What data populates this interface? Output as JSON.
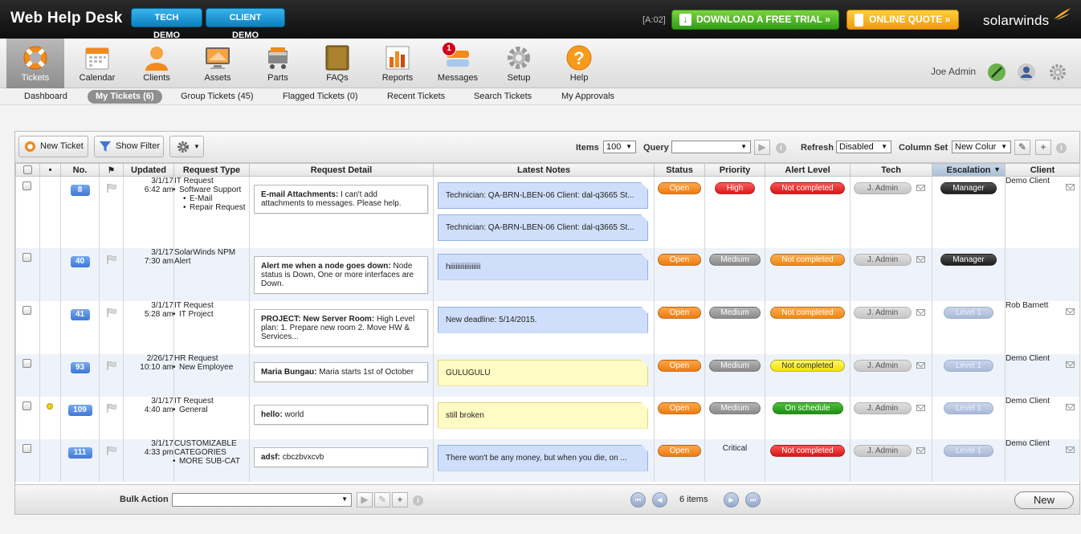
{
  "header": {
    "title": "Web Help Desk",
    "tech_demo": "TECH DEMO",
    "client_demo": "CLIENT DEMO",
    "version": "[A:02]",
    "download_trial": "DOWNLOAD A FREE TRIAL »",
    "online_quote": "ONLINE QUOTE »",
    "brand": "solarwinds",
    "colors": {
      "accent": "#0b80c0",
      "trial": "#2f9e16",
      "quote": "#f19a0e",
      "brand_flame": "#f5a623"
    }
  },
  "nav": {
    "items": [
      {
        "label": "Tickets",
        "icon": "lifebuoy-icon",
        "active": true
      },
      {
        "label": "Calendar",
        "icon": "calendar-icon"
      },
      {
        "label": "Clients",
        "icon": "person-icon"
      },
      {
        "label": "Assets",
        "icon": "monitor-icon"
      },
      {
        "label": "Parts",
        "icon": "cart-icon"
      },
      {
        "label": "FAQs",
        "icon": "book-icon"
      },
      {
        "label": "Reports",
        "icon": "report-icon"
      },
      {
        "label": "Messages",
        "icon": "message-icon",
        "badge": "1"
      },
      {
        "label": "Setup",
        "icon": "gear-icon"
      },
      {
        "label": "Help",
        "icon": "help-icon"
      }
    ],
    "user": "Joe Admin"
  },
  "subnav": {
    "items": [
      "Dashboard",
      "My Tickets (6)",
      "Group Tickets (45)",
      "Flagged Tickets (0)",
      "Recent Tickets",
      "Search Tickets",
      "My Approvals"
    ],
    "active": "My Tickets (6)"
  },
  "toolbar": {
    "new_ticket": "New Ticket",
    "show_filter": "Show Filter",
    "items_label": "Items",
    "items_value": "100",
    "query_label": "Query",
    "query_value": "",
    "refresh_label": "Refresh",
    "refresh_value": "Disabled",
    "column_set_label": "Column Set",
    "column_set_value": "New Colur"
  },
  "columns": [
    "",
    "•",
    "No.",
    "",
    "Updated",
    "Request Type",
    "Request Detail",
    "Latest Notes",
    "Status",
    "Priority",
    "Alert Level",
    "Tech",
    "Escalation",
    "Client"
  ],
  "rows": [
    {
      "no": "8",
      "date": "3/1/17",
      "time": "6:42 am",
      "rtype": "IT Request",
      "rsub": [
        {
          "t": "Software Support",
          "lvl": 1
        },
        {
          "t": "E-Mail",
          "lvl": 2
        },
        {
          "t": "Repair Request",
          "lvl": 2
        }
      ],
      "detail_title": "E-mail Attachments:",
      "detail_body": "I can't add attachments to messages. Please help.",
      "notes": [
        "Technician: QA-BRN-LBEN-06 Client: dal-q3665 St...",
        "Technician: QA-BRN-LBEN-06 Client: dal-q3665 St..."
      ],
      "note_color": "blue",
      "status": "Open",
      "priority": "High",
      "priority_style": "high",
      "alert": "Not completed",
      "alert_style": "red",
      "tech": "J. Admin",
      "escalation": "Manager",
      "esc_style": "mgr",
      "client": "Demo Client",
      "dot": false
    },
    {
      "no": "40",
      "date": "3/1/17",
      "time": "7:30 am",
      "rtype": "SolarWinds NPM Alert",
      "rsub": [],
      "detail_title": "Alert me when a node goes down:",
      "detail_body": "Node status is Down, One or more interfaces are Down.",
      "notes": [
        "hiiiiiiiiiiiiiiiii"
      ],
      "note_color": "blue",
      "status": "Open",
      "priority": "Medium",
      "priority_style": "med",
      "alert": "Not completed",
      "alert_style": "orange",
      "tech": "J. Admin",
      "escalation": "Manager",
      "esc_style": "mgr",
      "client": "",
      "dot": false
    },
    {
      "no": "41",
      "date": "3/1/17",
      "time": "5:28 am",
      "rtype": "IT Request",
      "rsub": [
        {
          "t": "IT Project",
          "lvl": 1
        }
      ],
      "detail_title": "PROJECT: New Server Room:",
      "detail_body": "High Level plan: 1. Prepare new room 2. Move HW & Services...",
      "notes": [
        "New deadline: 5/14/2015."
      ],
      "note_color": "blue",
      "status": "Open",
      "priority": "Medium",
      "priority_style": "med",
      "alert": "Not completed",
      "alert_style": "orange",
      "tech": "J. Admin",
      "escalation": "Level 1",
      "esc_style": "lvl",
      "client": "Rob Barnett",
      "dot": false
    },
    {
      "no": "93",
      "date": "2/26/17",
      "time": "10:10 am",
      "rtype": "HR Request",
      "rsub": [
        {
          "t": "New Employee",
          "lvl": 1
        }
      ],
      "detail_title": "Maria Bungau:",
      "detail_body": "Maria starts 1st of October",
      "notes": [
        "GULUGULU"
      ],
      "note_color": "yellow",
      "status": "Open",
      "priority": "Medium",
      "priority_style": "med",
      "alert": "Not completed",
      "alert_style": "yellow",
      "tech": "J. Admin",
      "escalation": "Level 1",
      "esc_style": "lvl",
      "client": "Demo Client",
      "dot": false
    },
    {
      "no": "109",
      "date": "3/1/17",
      "time": "4:40 am",
      "rtype": "IT Request",
      "rsub": [
        {
          "t": "General",
          "lvl": 1
        }
      ],
      "detail_title": "hello:",
      "detail_body": "world",
      "notes": [
        "still broken"
      ],
      "note_color": "yellow",
      "status": "Open",
      "priority": "Medium",
      "priority_style": "med",
      "alert": "On schedule",
      "alert_style": "green",
      "tech": "J. Admin",
      "escalation": "Level 1",
      "esc_style": "lvl",
      "client": "Demo Client",
      "dot": true
    },
    {
      "no": "111",
      "date": "3/1/17",
      "time": "4:33 pm",
      "rtype": "CUSTOMIZABLE CATEGORIES",
      "rsub": [
        {
          "t": "MORE SUB-CAT",
          "lvl": 1
        }
      ],
      "detail_title": "adsf:",
      "detail_body": "cbczbvxcvb",
      "notes": [
        "There won't be any money, but when you die, on ..."
      ],
      "note_color": "blue",
      "status": "Open",
      "priority": "Critical",
      "priority_style": "text",
      "alert": "Not completed",
      "alert_style": "red",
      "tech": "J. Admin",
      "escalation": "Level 1",
      "esc_style": "lvl",
      "client": "Demo Client",
      "dot": false
    }
  ],
  "footer": {
    "bulk_action": "Bulk Action",
    "items_count": "6 items",
    "new_button": "New"
  }
}
